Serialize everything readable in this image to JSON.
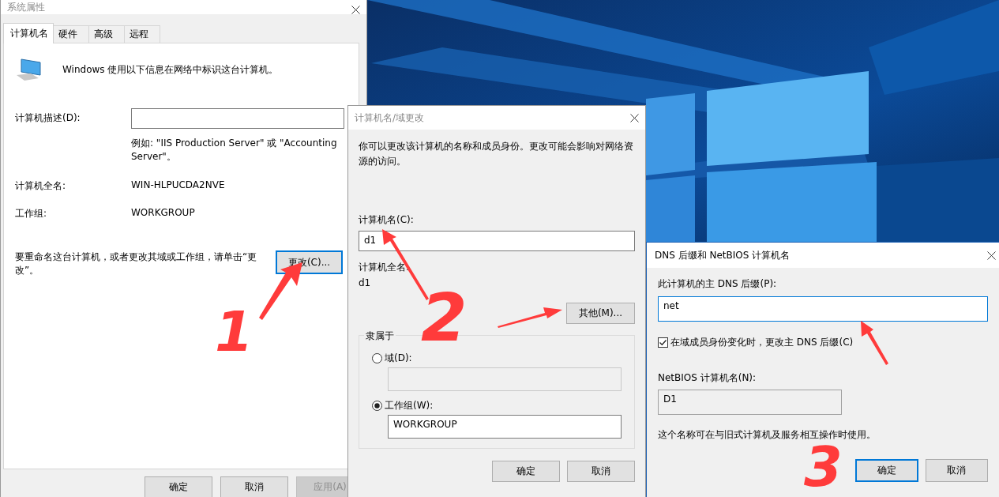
{
  "system_properties": {
    "title": "系统属性",
    "tabs": [
      {
        "label": "计算机名",
        "selected": true
      },
      {
        "label": "硬件",
        "selected": false
      },
      {
        "label": "高级",
        "selected": false
      },
      {
        "label": "远程",
        "selected": false
      }
    ],
    "intro": "Windows 使用以下信息在网络中标识这台计算机。",
    "description": {
      "label": "计算机描述(D):"
    },
    "example": "例如: \"IIS Production Server\" 或 \"Accounting Server\"。",
    "info_rows": [
      {
        "label": "计算机全名:",
        "value": "WIN-HLPUCDA2NVE"
      },
      {
        "label": "工作组:",
        "value": "WORKGROUP"
      }
    ],
    "rename_hint": "要重命名这台计算机，或者更改其域或工作组，请单击“更改”。",
    "change_button": {
      "label": "更改(C)...",
      "focused": true
    },
    "buttons": [
      {
        "label": "确定",
        "disabled": false
      },
      {
        "label": "取消",
        "disabled": false
      },
      {
        "label": "应用(A)",
        "disabled": true
      }
    ]
  },
  "name_change": {
    "title": "计算机名/域更改",
    "intro": "你可以更改该计算机的名称和成员身份。更改可能会影响对网络资源的访问。",
    "computer_name": {
      "label": "计算机名(C):",
      "value": "d1"
    },
    "full_name": {
      "label": "计算机全名:",
      "value": "d1"
    },
    "more_button": "其他(M)...",
    "member_of": {
      "legend": "隶属于",
      "options": [
        {
          "label": "域(D):",
          "selected": false,
          "field_disabled": true
        },
        {
          "label": "工作组(W):",
          "selected": true,
          "field_disabled": false,
          "value": "WORKGROUP"
        }
      ]
    },
    "buttons": [
      "确定",
      "取消"
    ]
  },
  "dns_dialog": {
    "title": "DNS 后缀和 NetBIOS 计算机名",
    "suffix": {
      "label": "此计算机的主 DNS 后缀(P):",
      "value": "net",
      "focused": true
    },
    "change_suffix": {
      "label": "在域成员身份变化时，更改主 DNS 后缀(C)",
      "checked": true
    },
    "netbios": {
      "label": "NetBIOS 计算机名(N):",
      "value": "D1"
    },
    "note": "这个名称可在与旧式计算机及服务相互操作时使用。",
    "buttons": [
      {
        "label": "确定",
        "focused": true
      },
      {
        "label": "取消",
        "focused": false
      }
    ]
  },
  "annotations": [
    {
      "text": "1"
    },
    {
      "text": "2"
    },
    {
      "text": "3"
    }
  ]
}
